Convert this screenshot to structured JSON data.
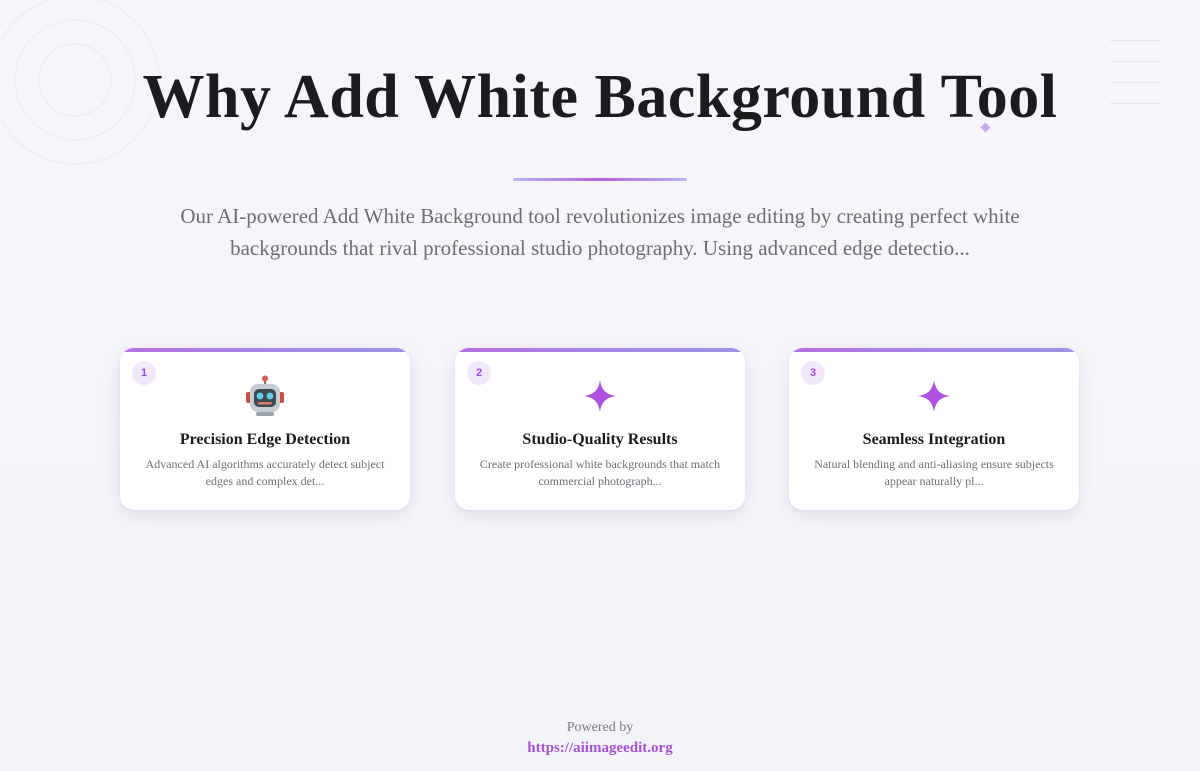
{
  "hero": {
    "title": "Why Add White Background Tool",
    "description": "Our AI-powered Add White Background tool revolutionizes image editing by creating perfect white backgrounds that rival professional studio photography. Using advanced edge detectio..."
  },
  "features": [
    {
      "number": "1",
      "icon": "robot-icon",
      "title": "Precision Edge Detection",
      "text": "Advanced AI algorithms accurately detect subject edges and complex det..."
    },
    {
      "number": "2",
      "icon": "sparkle-icon",
      "title": "Studio-Quality Results",
      "text": "Create professional white backgrounds that match commercial photograph..."
    },
    {
      "number": "3",
      "icon": "sparkle-icon",
      "title": "Seamless Integration",
      "text": "Natural blending and anti-aliasing ensure subjects appear naturally pl..."
    }
  ],
  "footer": {
    "powered_by": "Powered by",
    "link": "https://aiimageedit.org"
  },
  "colors": {
    "accent": "#a552d6",
    "sparkle": "#b150e0",
    "title": "#1c1c1e",
    "muted_text": "#6d6d76"
  }
}
